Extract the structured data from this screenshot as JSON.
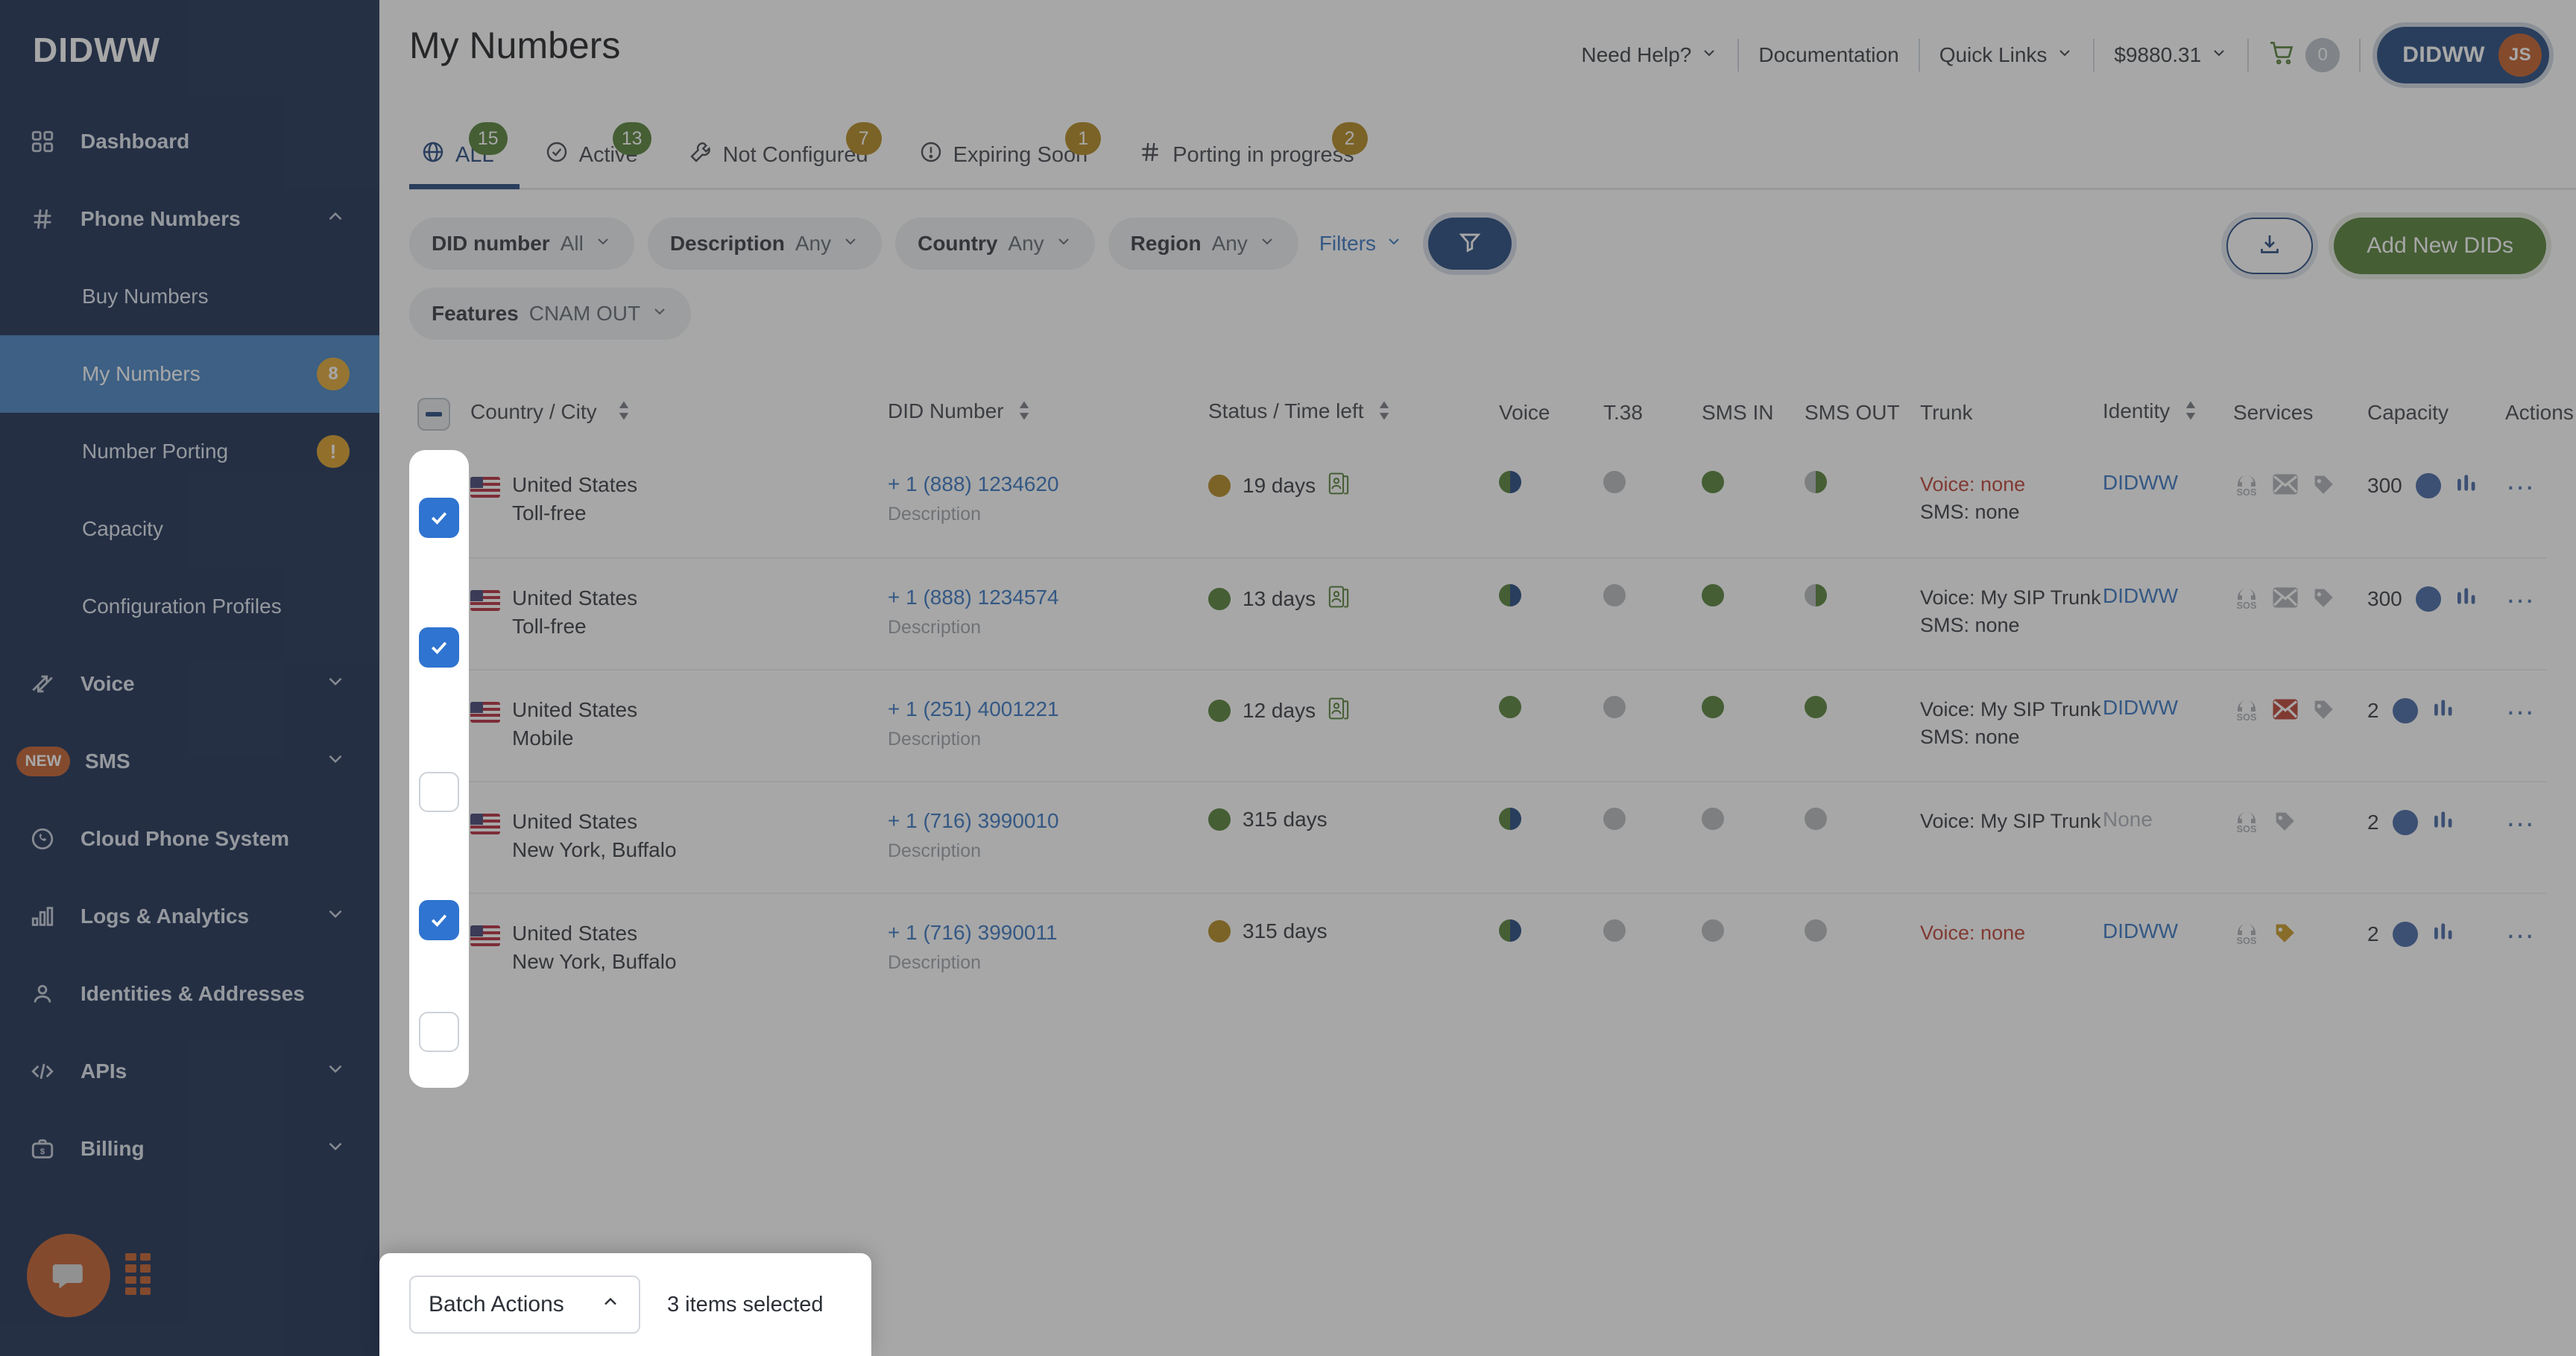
{
  "brand": "DIDWW",
  "sidebar": {
    "items": [
      {
        "label": "Dashboard",
        "icon": "grid-icon",
        "type": "item"
      },
      {
        "label": "Phone Numbers",
        "icon": "hash-icon",
        "type": "group",
        "chev": "up"
      },
      {
        "label": "Buy Numbers",
        "type": "sub"
      },
      {
        "label": "My Numbers",
        "type": "sub",
        "active": true,
        "badge": "8"
      },
      {
        "label": "Number Porting",
        "type": "sub",
        "warn": "!"
      },
      {
        "label": "Capacity",
        "type": "sub"
      },
      {
        "label": "Configuration Profiles",
        "type": "sub"
      },
      {
        "label": "Voice",
        "icon": "arrows-icon",
        "type": "group",
        "chev": "down"
      },
      {
        "label": "SMS",
        "icon": "new-pill",
        "pill": "NEW",
        "type": "group",
        "chev": "down"
      },
      {
        "label": "Cloud Phone System",
        "icon": "phone-circle-icon",
        "type": "item"
      },
      {
        "label": "Logs & Analytics",
        "icon": "bars-icon",
        "type": "group",
        "chev": "down"
      },
      {
        "label": "Identities & Addresses",
        "icon": "person-icon",
        "type": "item"
      },
      {
        "label": "APIs",
        "icon": "code-icon",
        "type": "group",
        "chev": "down"
      },
      {
        "label": "Billing",
        "icon": "briefcase-dollar-icon",
        "type": "group",
        "chev": "down"
      }
    ]
  },
  "header": {
    "title": "My Numbers",
    "need_help": "Need Help?",
    "documentation": "Documentation",
    "quick_links": "Quick Links",
    "balance": "$9880.31",
    "cart_count": "0",
    "account_name": "DIDWW",
    "account_initials": "JS"
  },
  "tabs": [
    {
      "label": "ALL",
      "badge": "15",
      "badge_color": "green",
      "icon": "globe-icon",
      "active": true
    },
    {
      "label": "Active",
      "badge": "13",
      "badge_color": "green",
      "icon": "check-circle-icon",
      "active": false
    },
    {
      "label": "Not Configured",
      "badge": "7",
      "badge_color": "amber",
      "icon": "wrench-icon",
      "active": false
    },
    {
      "label": "Expiring Soon",
      "badge": "1",
      "badge_color": "amber",
      "icon": "alert-circle-icon",
      "active": false
    },
    {
      "label": "Porting in progress",
      "badge": "2",
      "badge_color": "amber",
      "icon": "hash-icon",
      "active": false
    }
  ],
  "filters": {
    "chips": [
      {
        "label": "DID number",
        "value": "All"
      },
      {
        "label": "Description",
        "value": "Any"
      },
      {
        "label": "Country",
        "value": "Any"
      },
      {
        "label": "Region",
        "value": "Any"
      }
    ],
    "chips_row2": [
      {
        "label": "Features",
        "value": "CNAM OUT"
      }
    ],
    "filters_link": "Filters",
    "funnel_icon": "funnel-icon"
  },
  "actions": {
    "download_icon": "download-icon",
    "add_new": "Add New DIDs"
  },
  "table": {
    "columns": [
      {
        "key": "checkbox",
        "label": "",
        "sortable": false
      },
      {
        "key": "country_city",
        "label": "Country / City",
        "sortable": true
      },
      {
        "key": "did_number",
        "label": "DID Number",
        "sortable": true
      },
      {
        "key": "status",
        "label": "Status / Time left",
        "sortable": true
      },
      {
        "key": "voice",
        "label": "Voice",
        "sortable": false
      },
      {
        "key": "t38",
        "label": "T.38",
        "sortable": false
      },
      {
        "key": "sms_in",
        "label": "SMS IN",
        "sortable": false
      },
      {
        "key": "sms_out",
        "label": "SMS OUT",
        "sortable": false
      },
      {
        "key": "trunk",
        "label": "Trunk",
        "sortable": false
      },
      {
        "key": "identity",
        "label": "Identity",
        "sortable": true
      },
      {
        "key": "services",
        "label": "Services",
        "sortable": false
      },
      {
        "key": "capacity",
        "label": "Capacity",
        "sortable": false
      },
      {
        "key": "actions",
        "label": "Actions",
        "sortable": false
      }
    ],
    "rows": [
      {
        "selected": true,
        "country": "United States",
        "city": "Toll-free",
        "did": "+ 1 (888) 1234620",
        "description": "Description",
        "status_dot": "amber",
        "time_left": "19 days",
        "has_id_doc": true,
        "voice": "half-blue",
        "t38": "grey",
        "sms_in": "green",
        "sms_out": "half-grey",
        "trunk_voice": "Voice: none",
        "trunk_voice_red": true,
        "trunk_sms": "SMS: none",
        "identity": "DIDWW",
        "services": [
          "sos-icon",
          "envelope-icon",
          "tag-icon"
        ],
        "service_colors": [
          "grey",
          "grey",
          "grey"
        ],
        "capacity": "300",
        "actions": "…"
      },
      {
        "selected": true,
        "country": "United States",
        "city": "Toll-free",
        "did": "+ 1 (888) 1234574",
        "description": "Description",
        "status_dot": "green",
        "time_left": "13 days",
        "has_id_doc": true,
        "voice": "half-blue",
        "t38": "grey",
        "sms_in": "green",
        "sms_out": "half-grey",
        "trunk_voice": "Voice: My SIP Trunk",
        "trunk_voice_red": false,
        "trunk_sms": "SMS: none",
        "identity": "DIDWW",
        "services": [
          "sos-icon",
          "envelope-icon",
          "tag-icon"
        ],
        "service_colors": [
          "grey",
          "grey",
          "grey"
        ],
        "capacity": "300",
        "actions": "…"
      },
      {
        "selected": false,
        "country": "United States",
        "city": "Mobile",
        "did": "+ 1 (251) 4001221",
        "description": "Description",
        "status_dot": "green",
        "time_left": "12 days",
        "has_id_doc": true,
        "voice": "green",
        "t38": "grey",
        "sms_in": "green",
        "sms_out": "green",
        "trunk_voice": "Voice: My SIP Trunk",
        "trunk_voice_red": false,
        "trunk_sms": "SMS: none",
        "identity": "DIDWW",
        "services": [
          "sos-icon",
          "envelope-icon",
          "tag-icon"
        ],
        "service_colors": [
          "grey",
          "red",
          "grey"
        ],
        "capacity": "2",
        "actions": "…"
      },
      {
        "selected": true,
        "country": "United States",
        "city": "New York, Buffalo",
        "did": "+ 1 (716) 3990010",
        "description": "Description",
        "status_dot": "green",
        "time_left": "315 days",
        "has_id_doc": false,
        "voice": "half-blue",
        "t38": "grey",
        "sms_in": "grey",
        "sms_out": "grey",
        "trunk_voice": "Voice: My SIP Trunk",
        "trunk_voice_red": false,
        "trunk_sms": "",
        "identity": "None",
        "identity_none": true,
        "services": [
          "sos-icon",
          "tag-icon"
        ],
        "service_colors": [
          "grey",
          "grey"
        ],
        "capacity": "2",
        "actions": "…"
      },
      {
        "selected": false,
        "country": "United States",
        "city": "New York, Buffalo",
        "did": "+ 1 (716) 3990011",
        "description": "Description",
        "status_dot": "amber",
        "time_left": "315 days",
        "has_id_doc": false,
        "voice": "half-blue",
        "t38": "grey",
        "sms_in": "grey",
        "sms_out": "grey",
        "trunk_voice": "Voice: none",
        "trunk_voice_red": true,
        "trunk_sms": "",
        "identity": "DIDWW",
        "services": [
          "sos-icon",
          "tag-icon"
        ],
        "service_colors": [
          "grey",
          "gold"
        ],
        "capacity": "2",
        "actions": "…"
      }
    ]
  },
  "batch": {
    "label": "Batch Actions",
    "chevron": "chevron-up-icon",
    "info": "3 items selected"
  },
  "colors": {
    "sidebar_bg": "#12264b",
    "sidebar_active": "#3e7ec0",
    "brand_blue": "#1b4178",
    "link_blue": "#2f6fc0",
    "green": "#4d7a2e",
    "amber": "#b08316",
    "red": "#b93a2b",
    "orange": "#c05621"
  }
}
